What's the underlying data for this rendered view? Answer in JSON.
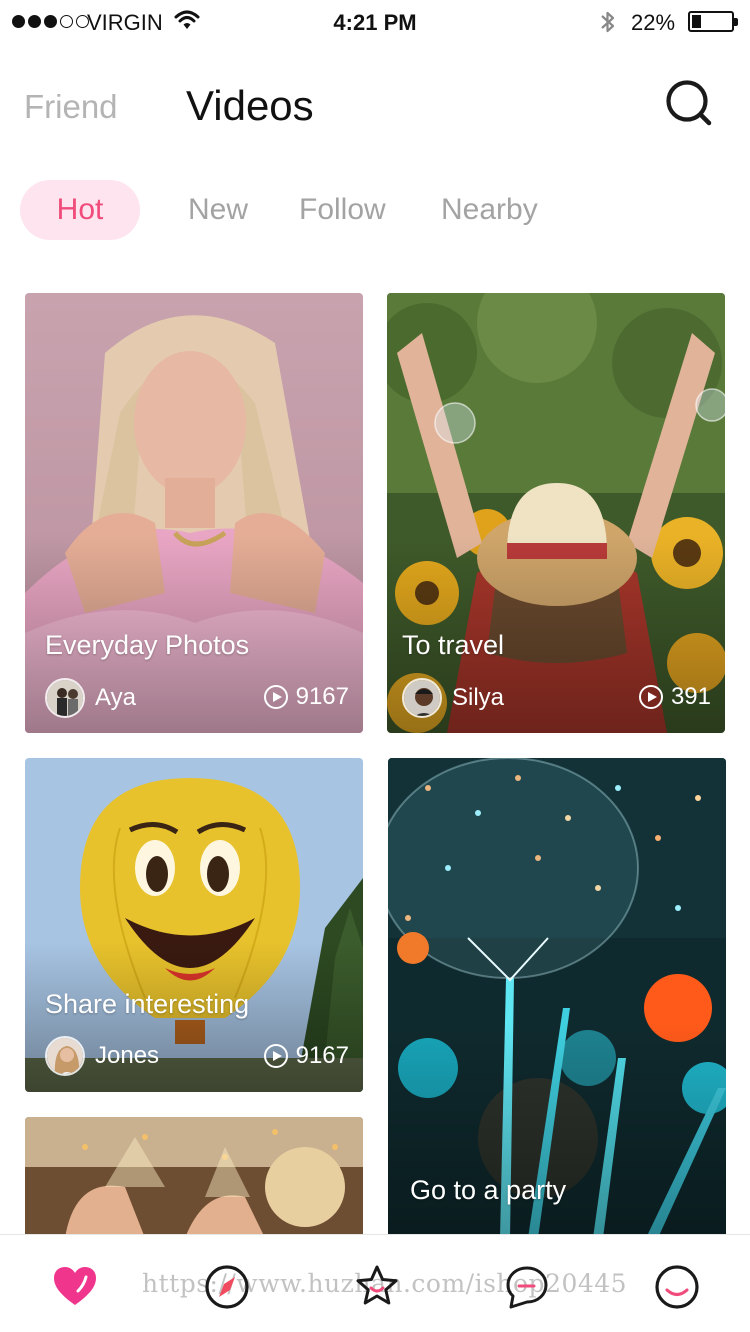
{
  "status_bar": {
    "carrier": "VIRGIN",
    "time": "4:21 PM",
    "battery": "22%",
    "battery_level": 0.22,
    "signal_bars": 3,
    "signal_total": 5
  },
  "header": {
    "tabs": [
      {
        "label": "Friend",
        "active": false
      },
      {
        "label": "Videos",
        "active": true
      }
    ],
    "search_icon": "search-icon"
  },
  "categories": [
    {
      "label": "Hot",
      "active": true
    },
    {
      "label": "New",
      "active": false
    },
    {
      "label": "Follow",
      "active": false
    },
    {
      "label": "Nearby",
      "active": false
    }
  ],
  "videos": [
    {
      "title": "Everyday Photos",
      "author": "Aya",
      "plays": "9167"
    },
    {
      "title": "To travel",
      "author": "Silya",
      "plays": "391"
    },
    {
      "title": "Share interesting",
      "author": "Jones",
      "plays": "9167"
    },
    {
      "title": "Go to a party"
    },
    {
      "title": ""
    }
  ],
  "bottom_nav": {
    "items": [
      {
        "icon": "heart-icon",
        "active": true
      },
      {
        "icon": "compass-icon",
        "active": false
      },
      {
        "icon": "star-icon",
        "active": false
      },
      {
        "icon": "chat-icon",
        "active": false
      },
      {
        "icon": "profile-icon",
        "active": false
      }
    ],
    "watermark": "https://www.huzhan.com/ishop20445"
  },
  "colors": {
    "accent": "#f04b7a",
    "chip_active_bg": "#fde4ee",
    "inactive_text": "#a3a3a3",
    "heart": "#f0358d"
  }
}
